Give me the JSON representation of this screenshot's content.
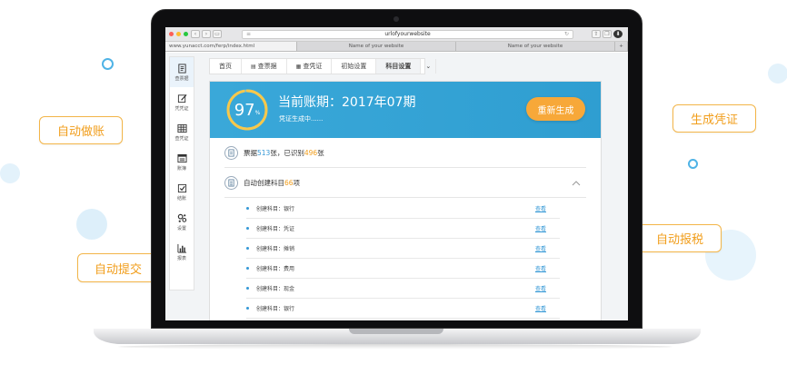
{
  "tags": {
    "auto_bookkeeping": "自动做账",
    "generate_voucher": "生成凭证",
    "auto_tax": "自动报税",
    "auto_submit": "自动提交"
  },
  "browser": {
    "address": "urlofyourwebsite",
    "tab_active": "www.yunacct.com/ferp/index.html",
    "tab2": "Name of your website",
    "tab3": "Name of your website"
  },
  "sidebar": {
    "items": [
      {
        "label": "查票据",
        "icon": "document-icon"
      },
      {
        "label": "凭凭证",
        "icon": "pencil-icon"
      },
      {
        "label": "查凭证",
        "icon": "grid-icon"
      },
      {
        "label": "账簿",
        "icon": "ledger-icon"
      },
      {
        "label": "结账",
        "icon": "check-icon"
      },
      {
        "label": "设置",
        "icon": "gears-icon"
      },
      {
        "label": "报表",
        "icon": "bar-chart-icon"
      }
    ]
  },
  "nav": {
    "home": "首页",
    "receipts": "查票据",
    "vouchers": "查凭证",
    "init": "初始设置",
    "accounts": "科目设置"
  },
  "hero": {
    "percent": "97",
    "percent_unit": "%",
    "period": "当前账期：2017年07期",
    "status": "凭证生成中......",
    "regen": "重新生成"
  },
  "receipts": {
    "prefix": "票据",
    "count": "513",
    "mid": "张，已识别",
    "recognized": "496",
    "suffix": "张"
  },
  "accounts": {
    "prefix": "自动创建科目",
    "count": "66",
    "suffix": "项"
  },
  "items": [
    {
      "label": "创建科目：银行",
      "view": "查看"
    },
    {
      "label": "创建科目：凭证",
      "view": "查看"
    },
    {
      "label": "创建科目：摊销",
      "view": "查看"
    },
    {
      "label": "创建科目：费用",
      "view": "查看"
    },
    {
      "label": "创建科目：现金",
      "view": "查看"
    },
    {
      "label": "创建科目：银行",
      "view": "查看"
    }
  ],
  "colors": {
    "accent": "#3598d6",
    "orange": "#f19d1a",
    "hero": "#3aa8d9"
  }
}
